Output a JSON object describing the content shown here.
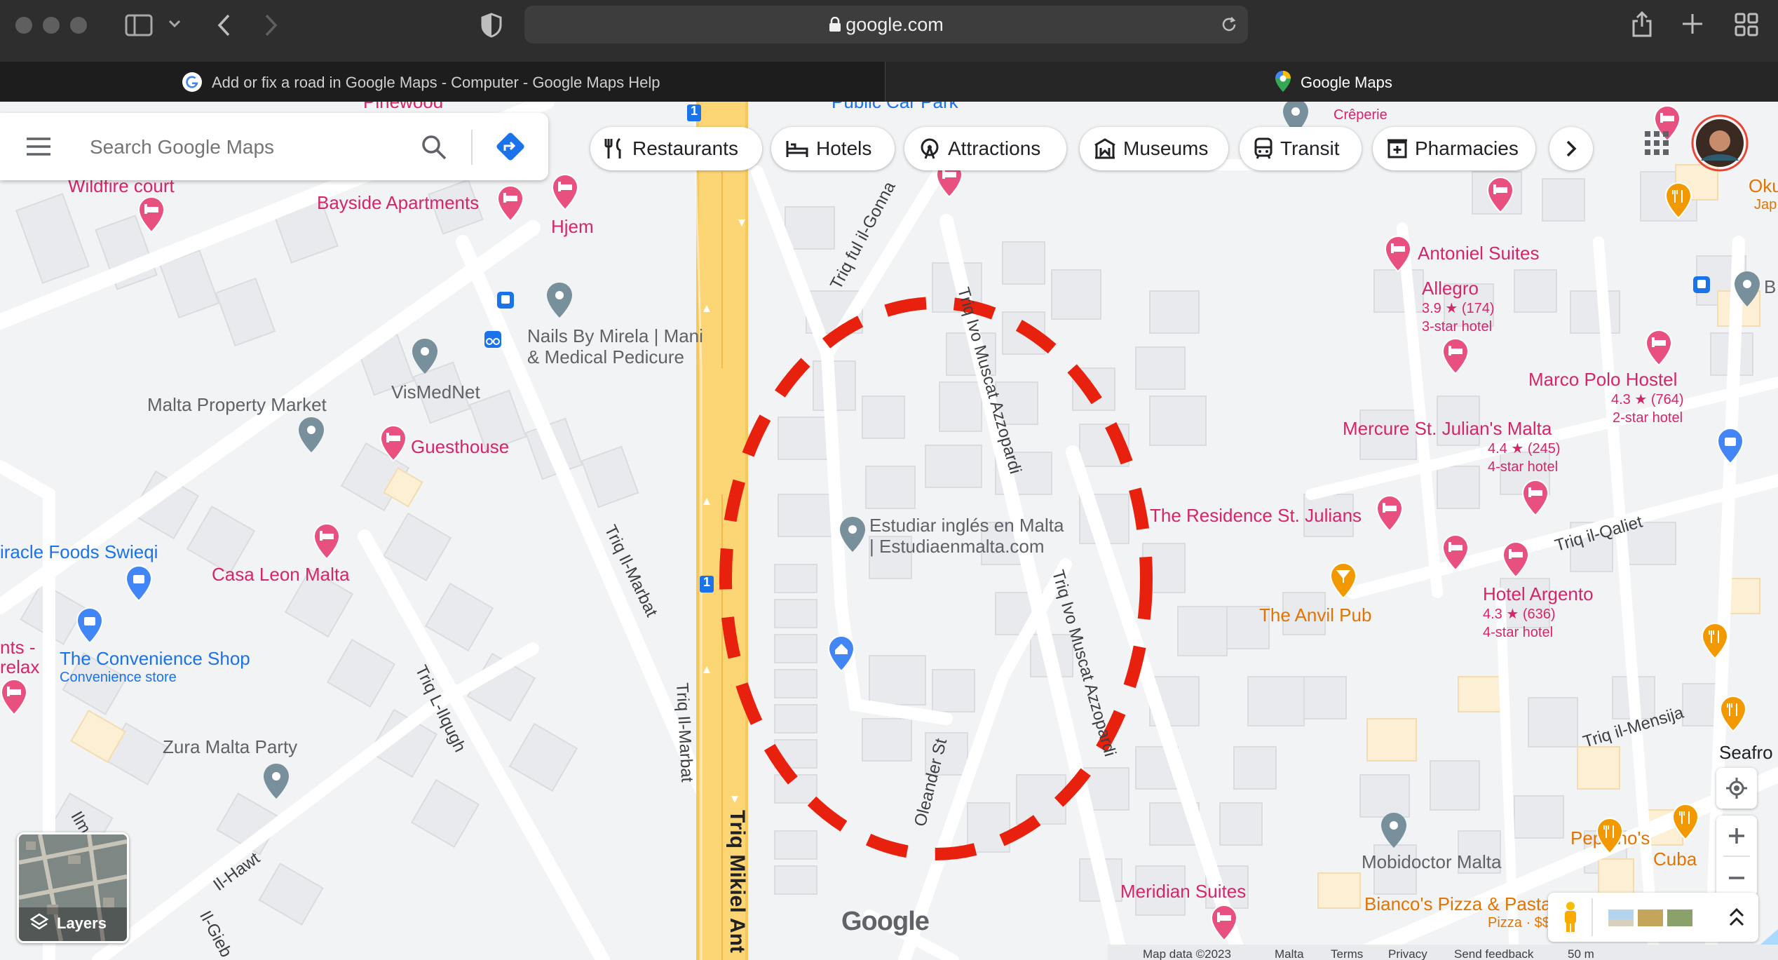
{
  "browser": {
    "url": "google.com",
    "tabs": [
      {
        "title": "Add or fix a road in Google Maps - Computer - Google Maps Help",
        "active": true
      },
      {
        "title": "Google Maps",
        "active": false
      }
    ]
  },
  "maps": {
    "search_placeholder": "Search Google Maps",
    "chips": [
      "Restaurants",
      "Hotels",
      "Attractions",
      "Museums",
      "Transit",
      "Pharmacies"
    ],
    "layers_label": "Layers",
    "logo": "Google",
    "footer": [
      "Map data ©2023",
      "Malta",
      "Terms",
      "Privacy",
      "Send feedback",
      "50 m"
    ]
  },
  "places": {
    "pinewood": "Pinewood",
    "public_car_park": "Public Car Park",
    "wildfire": "Wildfire court",
    "bayside": "Bayside Apartments",
    "hjem": "Hjem",
    "nails1": "Nails By Mirela | Mani",
    "nails2": "& Medical Pedicure",
    "vismednet": "VisMedNet",
    "malta_property": "Malta Property Market",
    "guesthouse": "Guesthouse",
    "miracle": "iracle Foods Swieqi",
    "casa_leon": "Casa Leon Malta",
    "nts": "nts -",
    "relax": "relax",
    "convenience": "The Convenience Shop",
    "convenience_sub": "Convenience store",
    "zura": "Zura Malta Party",
    "estudiar1": "Estudiar inglés en Malta",
    "estudiar2": "| Estudiaenmalta.com",
    "antoniel": "Antoniel Suites",
    "allegro": "Allegro",
    "allegro_rating": "3.9 ★ (174)",
    "allegro_class": "3-star hotel",
    "marco": "Marco Polo Hostel",
    "marco_rating": "4.3 ★ (764)",
    "marco_class": "2-star hotel",
    "mercure": "Mercure St. Julian's Malta",
    "mercure_rating": "4.4 ★ (245)",
    "mercure_class": "4-star hotel",
    "residence": "The Residence St. Julians",
    "anvil": "The Anvil Pub",
    "argento": "Hotel Argento",
    "argento_rating": "4.3 ★ (636)",
    "argento_class": "4-star hotel",
    "okuran": "Okuran",
    "okuran_sub": "Jap",
    "creperie": "Crêperie",
    "mobidoctor": "Mobidoctor Malta",
    "peppinos": "Peppino's",
    "cuba": "Cuba",
    "meridian": "Meridian Suites",
    "biancos": "Bianco's Pizza & Pasta",
    "biancos_sub": "Pizza · $$",
    "seafront": "Seafro",
    "b": "B"
  },
  "streets": {
    "gonna": "Triq ful il-Gonna",
    "azzopardi": "Triq Ivo Muscat Azzopardi",
    "marbat": "Triq Il-Marbat",
    "ilqugh": "Triq L-Ilqugh",
    "hawt": "Il-Hawt",
    "oleander": "Oleander St",
    "mikiel": "Triq Mikiel Ant",
    "qaliet": "Triq il-Qaliet",
    "mensija": "Triq il-Mensija",
    "ilm": "Ilm",
    "ilgieb": "Il-Gieb",
    "route_no": "1"
  },
  "colors": {
    "hotel_pink": "#d6256b",
    "poi_grey": "#70757a",
    "highway": "#fcd575",
    "annotation_red": "#e8210f",
    "link_blue": "#1a73e8",
    "food_orange": "#f29900"
  }
}
